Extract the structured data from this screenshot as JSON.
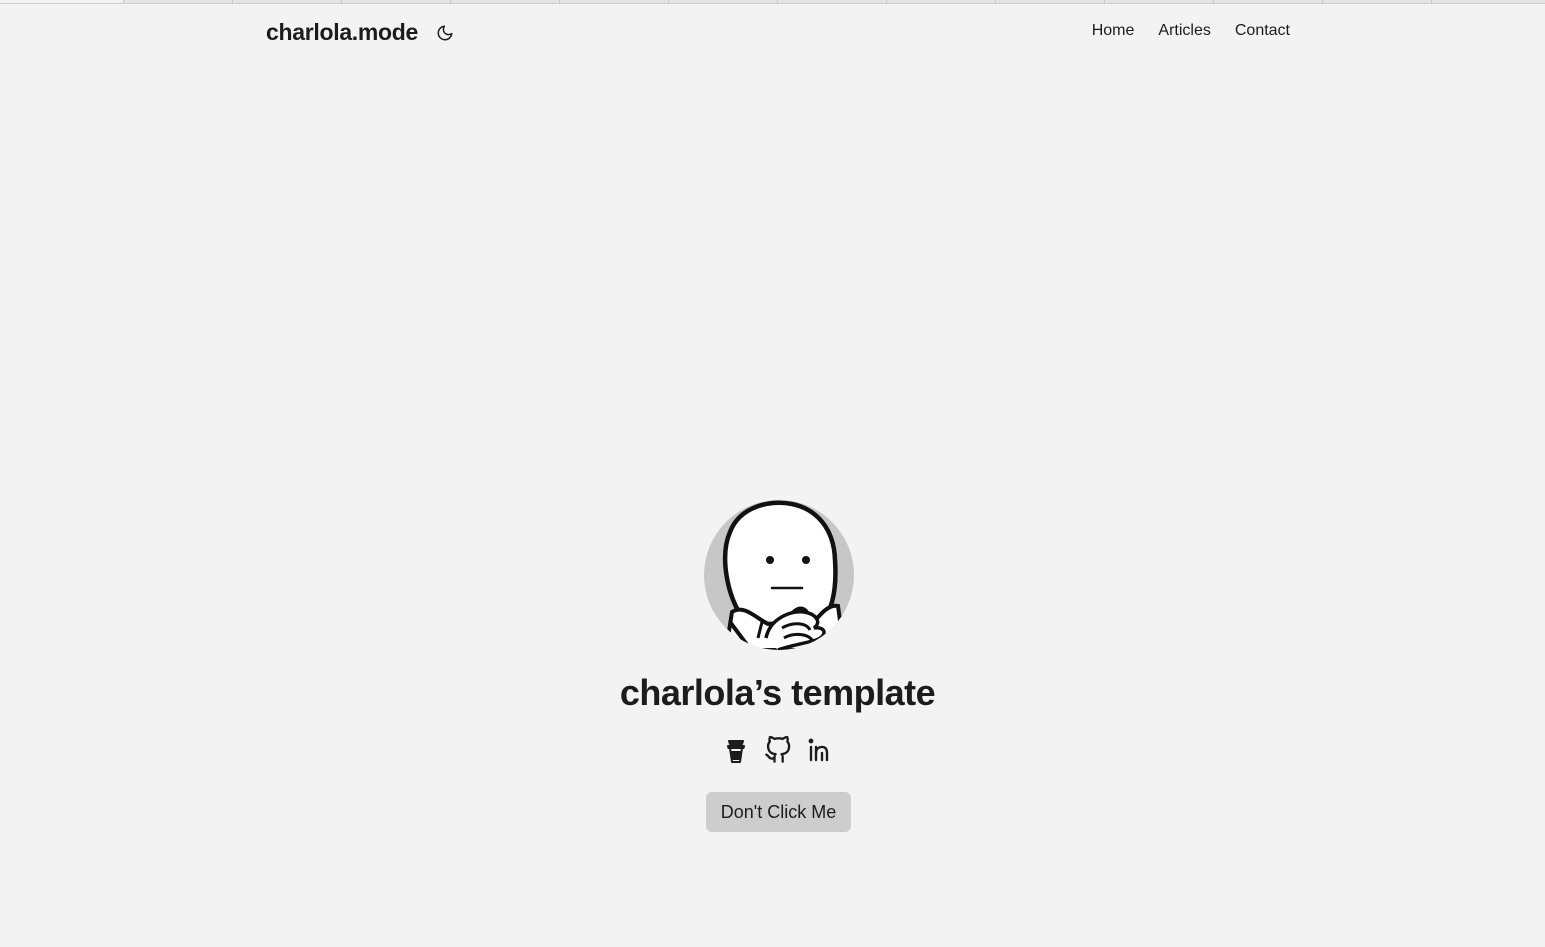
{
  "header": {
    "brand": "charlola.mode",
    "theme_toggle_icon": "moon-icon",
    "nav": [
      {
        "label": "Home"
      },
      {
        "label": "Articles"
      },
      {
        "label": "Contact"
      }
    ]
  },
  "hero": {
    "avatar_icon": "avatar-face-illustration",
    "title": "charlola’s template",
    "socials": [
      {
        "icon": "coffee-cup-icon"
      },
      {
        "icon": "github-icon"
      },
      {
        "icon": "linkedin-icon"
      }
    ],
    "cta_label": "Don't Click Me"
  },
  "colors": {
    "background": "#f3f3f3",
    "text": "#1c1c1c",
    "button_bg": "#cdcdcd",
    "avatar_bg": "#c7c7c7"
  }
}
